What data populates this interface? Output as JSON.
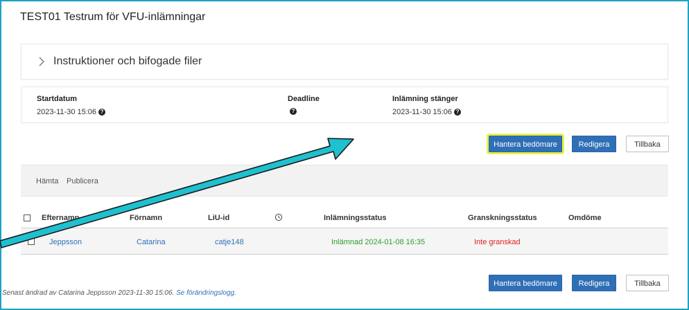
{
  "page": {
    "title": "TEST01 Testrum för VFU-inlämningar"
  },
  "instructions": {
    "label": "Instruktioner och bifogade filer"
  },
  "dates": {
    "start": {
      "label": "Startdatum",
      "value": "2023-11-30 15:06"
    },
    "deadline": {
      "label": "Deadline",
      "value": ""
    },
    "closes": {
      "label": "Inlämning stänger",
      "value": "2023-11-30 15:06"
    }
  },
  "actions": {
    "manage_label": "Hantera bedömare",
    "edit_label": "Redigera",
    "back_label": "Tillbaka"
  },
  "toolbar": {
    "fetch_label": "Hämta",
    "publish_label": "Publicera"
  },
  "table": {
    "headers": {
      "lastname": "Efternamn",
      "firstname": "Förnamn",
      "liu": "LiU-id",
      "status": "Inlämningsstatus",
      "review": "Granskningsstatus",
      "grade": "Omdöme"
    },
    "rows": [
      {
        "lastname": "Jeppsson",
        "firstname": "Catarina",
        "liu": "catje148",
        "status": "Inlämnad 2024-01-08 16:35",
        "review": "Inte granskad",
        "grade": ""
      }
    ]
  },
  "footer": {
    "text": "Senast ändrad av Catarina Jeppsson 2023-11-30 15:06.",
    "link": "Se förändringslogg."
  },
  "colors": {
    "primary": "#2f6fb6",
    "highlight": "#e8ef4a",
    "frame": "#1ba3c4",
    "arrow": "#1fc0cf",
    "status_ok": "#2e9d2e",
    "status_bad": "#e0201e"
  }
}
